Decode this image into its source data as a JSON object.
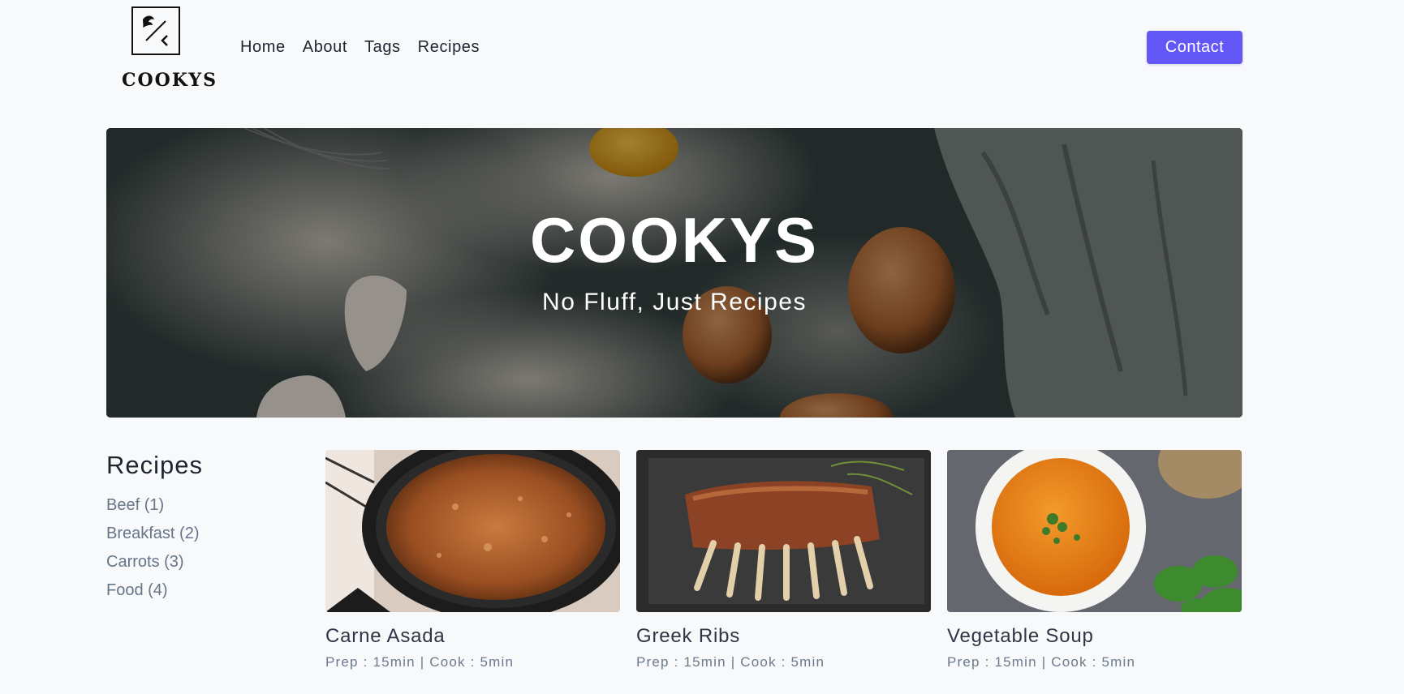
{
  "brand": {
    "logo_text": "COOKYS"
  },
  "nav": {
    "links": [
      "Home",
      "About",
      "Tags",
      "Recipes"
    ],
    "contact_label": "Contact"
  },
  "hero": {
    "title": "COOKYS",
    "subtitle": "No Fluff, Just Recipes"
  },
  "sidebar": {
    "title": "Recipes",
    "tags": [
      "Beef (1)",
      "Breakfast (2)",
      "Carrots (3)",
      "Food (4)"
    ]
  },
  "recipes": [
    {
      "title": "Carne Asada",
      "meta": "Prep : 15min | Cook : 5min"
    },
    {
      "title": "Greek Ribs",
      "meta": "Prep : 15min | Cook : 5min"
    },
    {
      "title": "Vegetable Soup",
      "meta": "Prep : 15min | Cook : 5min"
    }
  ],
  "colors": {
    "accent": "#6457f8",
    "background": "#f8f9fb",
    "text": "#1e2430",
    "muted": "#667588"
  }
}
